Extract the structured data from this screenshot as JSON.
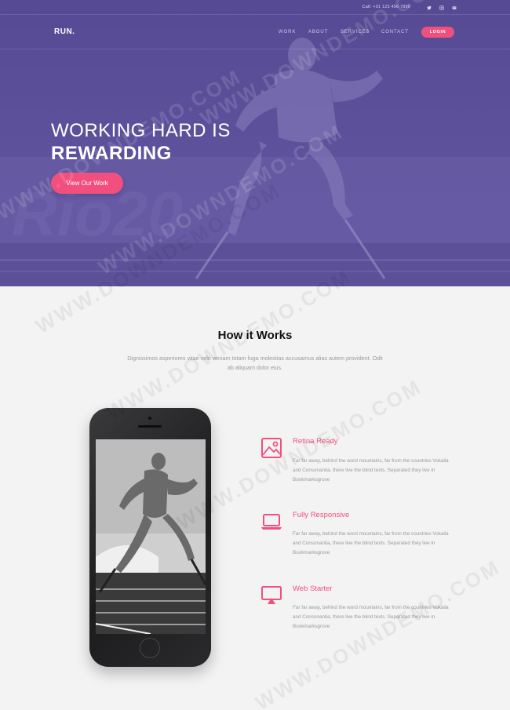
{
  "topbar": {
    "phone": "Call: +01 123 456 7890",
    "social": [
      {
        "icon": "twitter-icon"
      },
      {
        "icon": "instagram-icon"
      },
      {
        "icon": "email-icon"
      }
    ]
  },
  "nav": {
    "logo": "RUN.",
    "links": [
      "WORK",
      "ABOUT",
      "SERVICES",
      "CONTACT"
    ],
    "login": "LOGIN"
  },
  "hero": {
    "title_line1": "WORKING HARD IS",
    "title_line2": "REWARDING",
    "button": "View Our Work"
  },
  "how": {
    "title": "How it Works",
    "subtitle": "Dignissimos asperiores vitae velit veniam totam fuga molestias accusamus alias autem provident. Odit ab aliquam dolor eius.",
    "features": [
      {
        "icon": "image-icon",
        "title": "Retina Ready",
        "text": "Far far away, behind the word mountains, far from the countries Vokalia and Consonantia, there live the blind texts. Separated they live in Bookmarksgrove"
      },
      {
        "icon": "laptop-icon",
        "title": "Fully Responsive",
        "text": "Far far away, behind the word mountains, far from the countries Vokalia and Consonantia, there live the blind texts. Separated they live in Bookmarksgrove"
      },
      {
        "icon": "screen-share-icon",
        "title": "Web Starter",
        "text": "Far far away, behind the word mountains, far from the countries Vokalia and Consonantia, there live the blind texts. Separated they live in Bookmarksgrove"
      }
    ]
  },
  "watermark": "WWW.DOWNDEMO.COM",
  "colors": {
    "hero_bg": "#5a4e98",
    "accent": "#f1507e",
    "section_bg": "#f3f3f3"
  }
}
